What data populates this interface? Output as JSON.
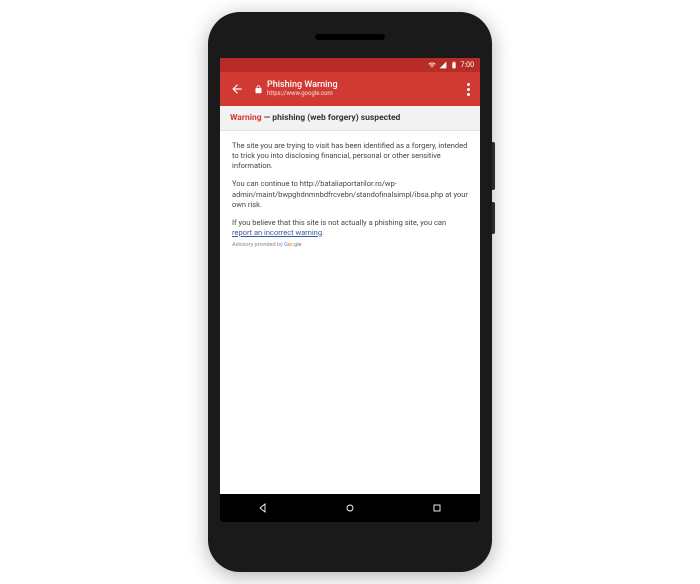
{
  "status": {
    "time": "7:00"
  },
  "toolbar": {
    "title": "Phishing Warning",
    "url": "https://www.google.com"
  },
  "banner": {
    "warning_word": "Warning",
    "rest": " — phishing (web forgery) suspected"
  },
  "body": {
    "p1": "The site you are trying to visit has been identified as a forgery, intended to trick you into disclosing financial, personal or other sensitive information.",
    "p2": "You can continue to http://bataliaportarilor.ro/wp-admin/maint/bwpghdnmnbdfrcvebn/standofinalsimpl/ibsa.php at your own risk.",
    "p3_prefix": "If you believe that this site is not actually a phishing site, you can ",
    "p3_link": "report an incorrect warning",
    "p3_suffix": ".",
    "advisory_prefix": "Advisory provided by "
  }
}
